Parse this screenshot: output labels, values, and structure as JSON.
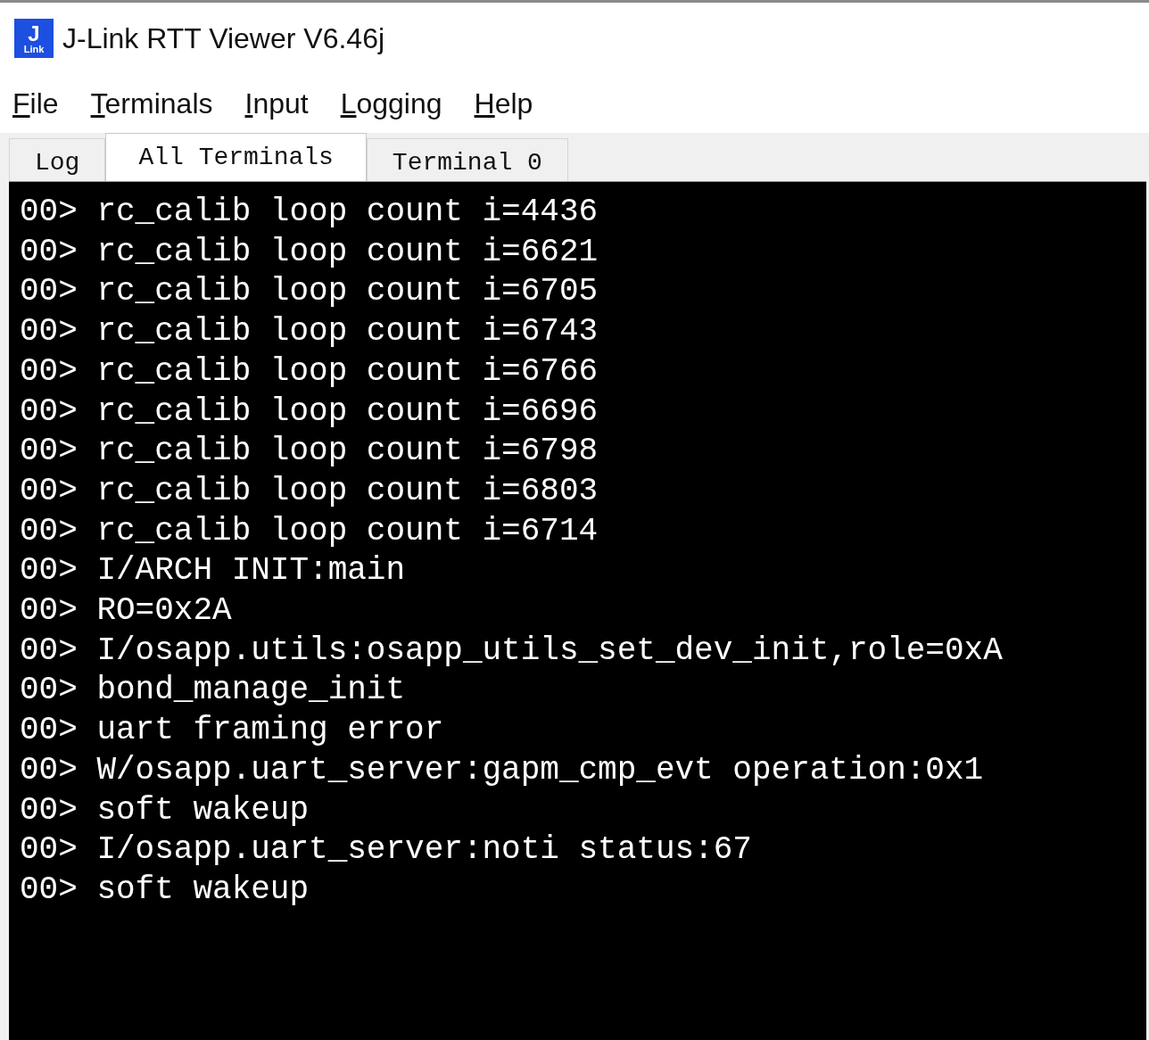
{
  "window": {
    "title": "J-Link RTT Viewer V6.46j",
    "app_icon": {
      "top": "J",
      "bottom": "Link"
    }
  },
  "menu": [
    {
      "label": "File",
      "underline_first": true
    },
    {
      "label": "Terminals",
      "underline_first": true
    },
    {
      "label": "Input",
      "underline_first": true
    },
    {
      "label": "Logging",
      "underline_first": true
    },
    {
      "label": "Help",
      "underline_first": true
    }
  ],
  "tabs": [
    {
      "label": "Log",
      "selected": false
    },
    {
      "label": "All Terminals",
      "selected": true
    },
    {
      "label": "Terminal 0",
      "selected": false
    }
  ],
  "terminal_lines": [
    {
      "prefix": "00>",
      "text": "rc_calib loop count i=4436"
    },
    {
      "prefix": "00>",
      "text": "rc_calib loop count i=6621"
    },
    {
      "prefix": "00>",
      "text": "rc_calib loop count i=6705"
    },
    {
      "prefix": "00>",
      "text": "rc_calib loop count i=6743"
    },
    {
      "prefix": "00>",
      "text": "rc_calib loop count i=6766"
    },
    {
      "prefix": "00>",
      "text": "rc_calib loop count i=6696"
    },
    {
      "prefix": "00>",
      "text": "rc_calib loop count i=6798"
    },
    {
      "prefix": "00>",
      "text": "rc_calib loop count i=6803"
    },
    {
      "prefix": "00>",
      "text": "rc_calib loop count i=6714"
    },
    {
      "prefix": "00>",
      "text": "I/ARCH INIT:main"
    },
    {
      "prefix": "00>",
      "text": "RO=0x2A"
    },
    {
      "prefix": "00>",
      "text": "I/osapp.utils:osapp_utils_set_dev_init,role=0xA"
    },
    {
      "prefix": "00>",
      "text": "bond_manage_init"
    },
    {
      "prefix": "00>",
      "text": "uart framing error"
    },
    {
      "prefix": "00>",
      "text": "W/osapp.uart_server:gapm_cmp_evt operation:0x1"
    },
    {
      "prefix": "00>",
      "text": "soft wakeup"
    },
    {
      "prefix": "00>",
      "text": "I/osapp.uart_server:noti status:67"
    },
    {
      "prefix": "00>",
      "text": "soft wakeup"
    }
  ]
}
